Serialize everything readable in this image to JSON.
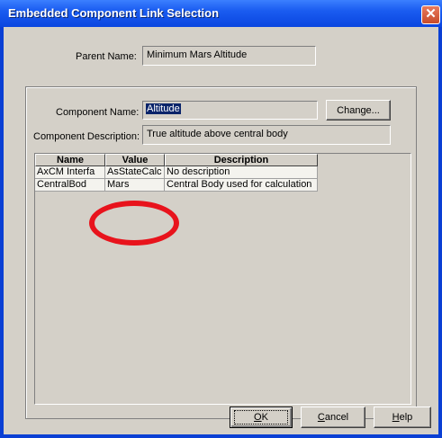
{
  "window": {
    "title": "Embedded Component Link Selection",
    "close_glyph": "✕"
  },
  "parent": {
    "label": "Parent Name:",
    "value": "Minimum Mars Altitude"
  },
  "component": {
    "name_label": "Component Name:",
    "name_value": "Altitude",
    "change_label": "Change...",
    "desc_label": "Component Description:",
    "desc_value": "True altitude above central body"
  },
  "grid": {
    "columns": [
      "Name",
      "Value",
      "Description"
    ],
    "rows": [
      [
        "AxCM Interfa",
        "AsStateCalc",
        "No description"
      ],
      [
        "CentralBod",
        "Mars",
        "Central Body used for calculation"
      ]
    ]
  },
  "buttons": {
    "ok": {
      "mnemonic": "O",
      "rest": "K"
    },
    "cancel": {
      "mnemonic": "C",
      "rest": "ancel"
    },
    "help": {
      "mnemonic": "H",
      "rest": "elp"
    }
  },
  "colors": {
    "title_bar": "#0a45e0",
    "dialog_bg": "#d4d0c8",
    "annotation": "#e8131c",
    "selection": "#0a246a"
  }
}
